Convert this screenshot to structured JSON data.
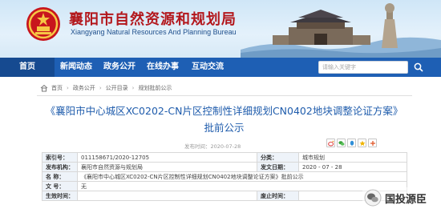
{
  "header": {
    "title": "襄阳市自然资源和规划局",
    "subtitle": "Xiangyang Natural Resources And Planning Bureau"
  },
  "nav": {
    "items": [
      "首页",
      "新闻动态",
      "政务公开",
      "在线办事",
      "互动交流"
    ],
    "active_index": 0,
    "search_placeholder": "请输入关键字"
  },
  "breadcrumb": {
    "items": [
      "首页",
      "政务公开",
      "公开目录",
      "规划批前公示"
    ]
  },
  "article": {
    "title": "《襄阳市中心城区XC0202-CN片区控制性详细规划CN0402地块调整论证方案》批前公示",
    "date_text": "发布时间：2020-07-28"
  },
  "info_table": {
    "index_label": "索引号：",
    "index_value": "011158671/2020-12705",
    "category_label": "分类：",
    "category_value": "城市规划",
    "publisher_label": "发布机构：",
    "publisher_value": "襄阳市自然资源与规划局",
    "date_label": "发文日期：",
    "date_value": "2020 - 07 - 28",
    "name_label": "名 称：",
    "name_value": "《襄阳市中心城区XC0202-CN片区控制性详细规划CN0402地块调整论证方案》批前公示",
    "docno_label": "文 号：",
    "docno_value": "无",
    "effective_label": "生效时间：",
    "effective_value": "",
    "expire_label": "废止时间：",
    "expire_value": ""
  },
  "watermark": {
    "text": "国投源臣"
  },
  "colors": {
    "nav_bg": "#1e5fb4",
    "title_red": "#b3171c",
    "article_blue": "#1f5cac"
  }
}
